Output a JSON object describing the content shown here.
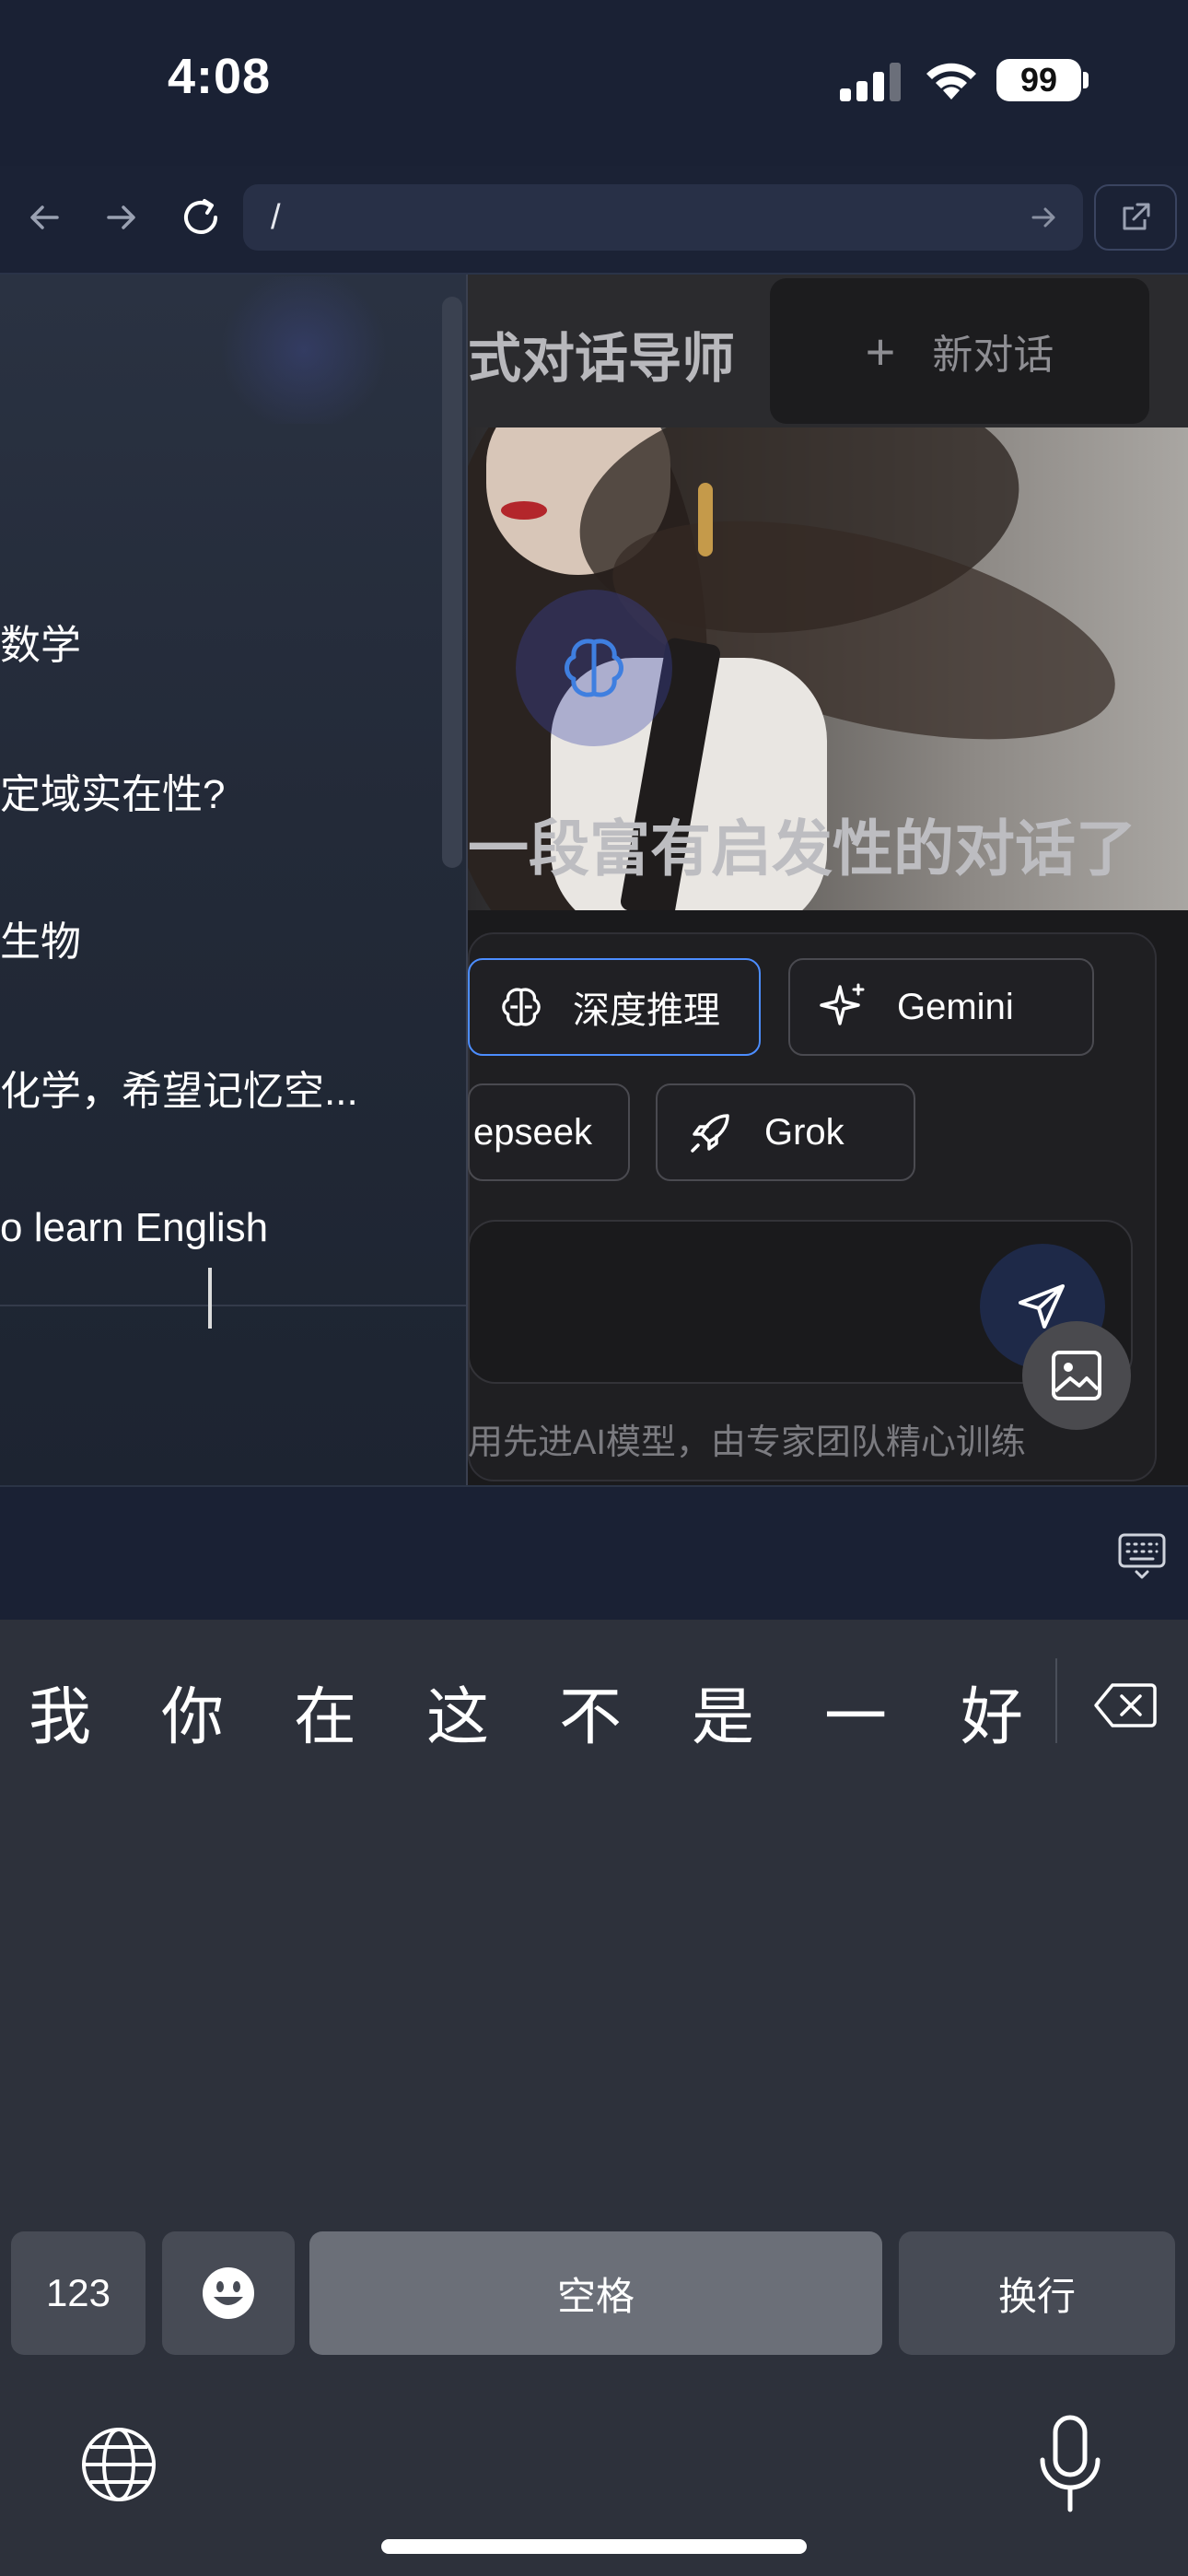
{
  "status_bar": {
    "time": "4:08",
    "battery": "99",
    "signal_icon": "cellular-signal-icon",
    "wifi_icon": "wifi-icon"
  },
  "browser": {
    "url": "/",
    "back_icon": "arrow-left-icon",
    "forward_icon": "arrow-right-icon",
    "reload_icon": "reload-icon",
    "go_icon": "arrow-right-icon",
    "external_icon": "external-link-icon"
  },
  "sidebar": {
    "items": [
      {
        "label": "数学"
      },
      {
        "label": "定域实在性?"
      },
      {
        "label": "生物"
      },
      {
        "label": "化学，希望记忆空..."
      },
      {
        "label": "o learn English"
      }
    ]
  },
  "header": {
    "title": "式对话导师",
    "new_chat_label": "新对话"
  },
  "hero": {
    "text": "一段富有启发性的对话了"
  },
  "models": {
    "chips": [
      {
        "label": "深度推理",
        "icon": "brain-icon",
        "active": true
      },
      {
        "label": "Gemini",
        "icon": "sparkle-icon",
        "active": false
      },
      {
        "label": "epseek",
        "icon": "none",
        "active": false
      },
      {
        "label": "Grok",
        "icon": "rocket-icon",
        "active": false
      }
    ]
  },
  "input": {
    "send_icon": "send-icon",
    "image_icon": "image-icon"
  },
  "footer": {
    "text": "用先进AI模型，由专家团队精心训练"
  },
  "keyboard": {
    "candidates": [
      "我",
      "你",
      "在",
      "这",
      "不",
      "是",
      "一",
      "好"
    ],
    "numbers_key": "123",
    "space_key": "空格",
    "return_key": "换行",
    "emoji_icon": "emoji-icon",
    "globe_icon": "globe-icon",
    "mic_icon": "microphone-icon",
    "delete_icon": "delete-icon",
    "keyboard_toggle_icon": "keyboard-icon"
  },
  "colors": {
    "accent_blue": "#4c8dff",
    "page_bg": "#1a2134",
    "keyboard_bg": "#2d313b"
  }
}
